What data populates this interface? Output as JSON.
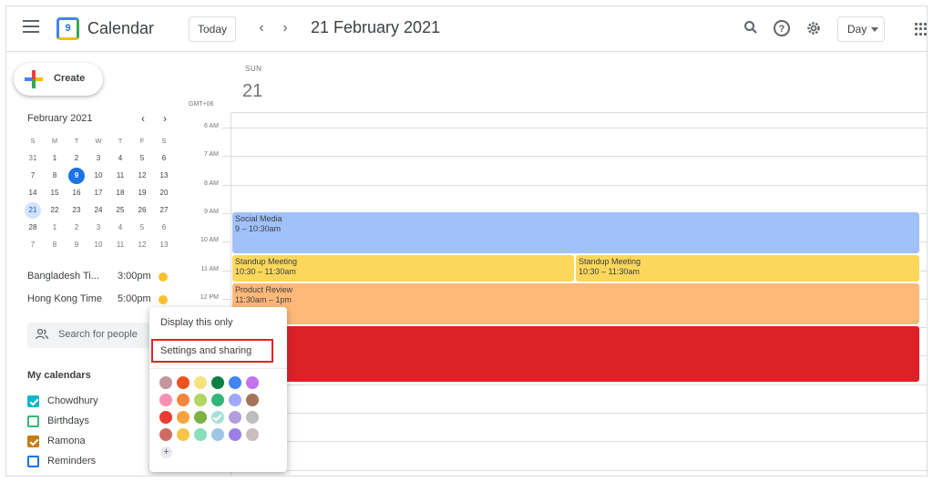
{
  "header": {
    "app_title": "Calendar",
    "logo_text": "9",
    "today_label": "Today",
    "date_title": "21 February 2021",
    "view_label": "Day"
  },
  "sidebar": {
    "create_label": "Create",
    "mini_calendar": {
      "title": "February 2021",
      "dow": [
        "S",
        "M",
        "T",
        "W",
        "T",
        "F",
        "S"
      ],
      "weeks": [
        [
          "31",
          "1",
          "2",
          "3",
          "4",
          "5",
          "6"
        ],
        [
          "7",
          "8",
          "9",
          "10",
          "11",
          "12",
          "13"
        ],
        [
          "14",
          "15",
          "16",
          "17",
          "18",
          "19",
          "20"
        ],
        [
          "21",
          "22",
          "23",
          "24",
          "25",
          "26",
          "27"
        ],
        [
          "28",
          "1",
          "2",
          "3",
          "4",
          "5",
          "6"
        ],
        [
          "7",
          "8",
          "9",
          "10",
          "11",
          "12",
          "13"
        ]
      ],
      "selected_day": "21",
      "today_day": "9"
    },
    "timezones": [
      {
        "name": "Bangladesh Ti...",
        "time": "3:00pm"
      },
      {
        "name": "Hong Kong Time",
        "time": "5:00pm"
      }
    ],
    "search_placeholder": "Search for people",
    "my_calendars_title": "My calendars",
    "calendars": [
      {
        "label": "Chowdhury",
        "checked": true,
        "color": "#12b5cb"
      },
      {
        "label": "Birthdays",
        "checked": false,
        "color": "#33b679"
      },
      {
        "label": "Ramona",
        "checked": true,
        "color": "#c77b12"
      },
      {
        "label": "Reminders",
        "checked": false,
        "color": "#1a73e8"
      }
    ]
  },
  "day_view": {
    "dow": "SUN",
    "day_number": "21",
    "timezone_label": "GMT+06",
    "hours": [
      "6 AM",
      "7 AM",
      "8 AM",
      "9 AM",
      "10 AM",
      "11 AM",
      "12 PM"
    ],
    "events": [
      {
        "title": "Social Media",
        "time": "9 – 10:30am",
        "color": "#a1c1fa"
      },
      {
        "title": "Standup Meeting",
        "time": "10:30 – 11:30am",
        "color": "#fbd75b"
      },
      {
        "title": "Standup Meeting",
        "time": "10:30 – 11:30am",
        "color": "#fbd75b"
      },
      {
        "title": "Product Review",
        "time": "11:30am – 1pm",
        "color": "#ffb878"
      },
      {
        "title": "",
        "time": "",
        "color": "#dc2127"
      }
    ]
  },
  "popup": {
    "display_only": "Display this only",
    "settings_sharing": "Settings and sharing",
    "add_color_symbol": "+",
    "swatches": [
      "#c2969f",
      "#f4511e",
      "#f6e27f",
      "#0b8043",
      "#4285f4",
      "#c572ee",
      "#f691b2",
      "#f4853d",
      "#b3d561",
      "#33b679",
      "#a0a8fa",
      "#a3745c",
      "#e93b30",
      "#f6a240",
      "#7cb342",
      "#a7e0d8",
      "#b39ddb",
      "#bdbdbd",
      "#d06b64",
      "#f6c447",
      "#86dfb6",
      "#9fc6e7",
      "#9b7fe6",
      "#cabdbf"
    ],
    "checked_swatch_index": 15
  }
}
